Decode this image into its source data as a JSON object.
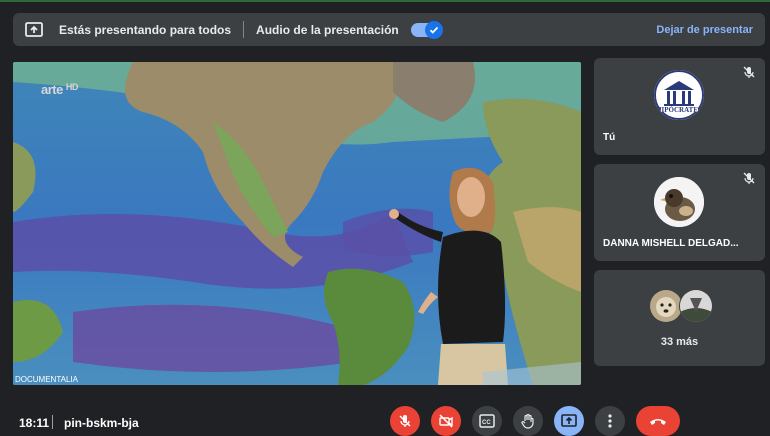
{
  "banner": {
    "presenting_text": "Estás presentando para todos",
    "audio_label": "Audio de la presentación",
    "audio_enabled": true,
    "stop_presenting_label": "Dejar de presentar"
  },
  "stage": {
    "channel_logo": "arte",
    "channel_hd": "HD",
    "credit": "DOCUMENTALIA"
  },
  "participants": [
    {
      "name": "Tú",
      "avatar_text": "HIPÓCRATES",
      "muted": true
    },
    {
      "name": "DANNA MISHELL DELGAD...",
      "muted": true
    }
  ],
  "more": {
    "count_label": "33 más"
  },
  "bottom": {
    "time": "18:11",
    "meeting_code": "pin-bskm-bja"
  },
  "controls": [
    "mic-off-icon",
    "camera-off-icon",
    "captions-icon",
    "raise-hand-icon",
    "present-screen-icon",
    "more-options-icon",
    "hang-up-icon"
  ],
  "colors": {
    "accent": "#8ab4f8",
    "danger": "#ea4335",
    "tile": "#3c4043",
    "background": "#202124"
  }
}
